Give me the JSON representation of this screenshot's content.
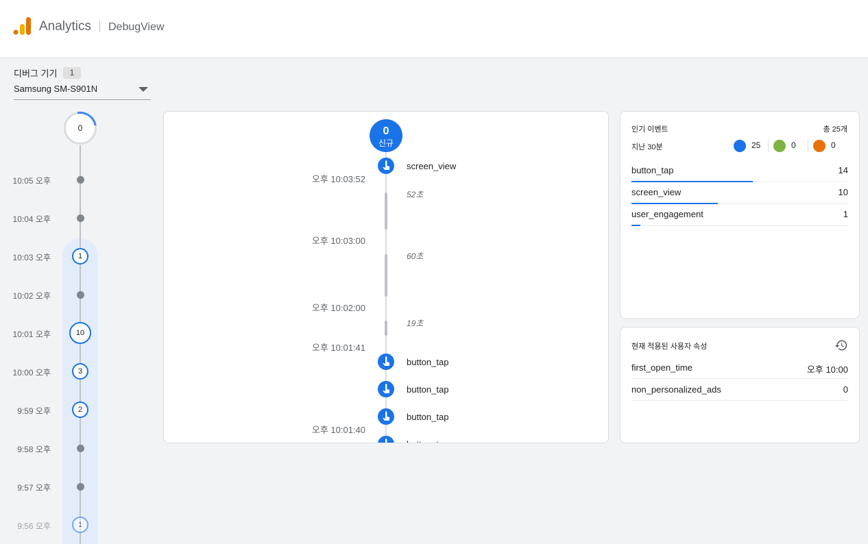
{
  "header": {
    "app_name": "Analytics",
    "page_name": "DebugView"
  },
  "device": {
    "label": "디버그 기기",
    "count": "1",
    "selected": "Samsung SM-S901N"
  },
  "minutes": {
    "top_count": "0",
    "rows": [
      {
        "time": "10:05 오후",
        "count": ""
      },
      {
        "time": "10:04 오후",
        "count": ""
      },
      {
        "time": "10:03 오후",
        "count": "1"
      },
      {
        "time": "10:02 오후",
        "count": ""
      },
      {
        "time": "10:01 오후",
        "count": "10"
      },
      {
        "time": "10:00 오후",
        "count": "3"
      },
      {
        "time": "9:59 오후",
        "count": "2"
      },
      {
        "time": "9:58 오후",
        "count": ""
      },
      {
        "time": "9:57 오후",
        "count": ""
      },
      {
        "time": "9:56 오후",
        "count": "1"
      }
    ]
  },
  "stream": {
    "new_count": "0",
    "new_label": "신규",
    "events": [
      {
        "name": "screen_view"
      },
      {
        "name": "button_tap"
      },
      {
        "name": "button_tap"
      },
      {
        "name": "button_tap"
      },
      {
        "name": "button_tap"
      }
    ],
    "timestamps": [
      "오후 10:03:52",
      "오후 10:03:00",
      "오후 10:02:00",
      "오후 10:01:41",
      "오후 10:01:40"
    ],
    "gaps": [
      "52초",
      "60초",
      "19초"
    ]
  },
  "top_events": {
    "title": "인기 이벤트",
    "total": "총 25개",
    "period": "지난 30분",
    "type_counts": [
      {
        "icon": "touch-icon",
        "color": "#1a73e8",
        "value": "25"
      },
      {
        "icon": "flag-icon",
        "color": "#7cb342",
        "value": "0"
      },
      {
        "icon": "bug-icon",
        "color": "#e8710a",
        "value": "0"
      }
    ],
    "rows": [
      {
        "name": "button_tap",
        "count": "14",
        "share": 0.56
      },
      {
        "name": "screen_view",
        "count": "10",
        "share": 0.4
      },
      {
        "name": "user_engagement",
        "count": "1",
        "share": 0.04
      }
    ]
  },
  "user_props": {
    "title": "현재 적용된 사용자 속성",
    "rows": [
      {
        "name": "first_open_time",
        "value": "오후 10:00"
      },
      {
        "name": "non_personalized_ads",
        "value": "0"
      }
    ]
  }
}
